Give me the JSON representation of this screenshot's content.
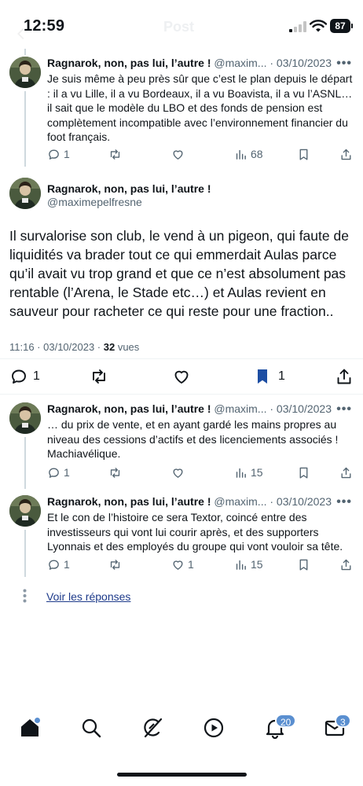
{
  "status_bar": {
    "time": "12:59",
    "header_title_faded": "Post",
    "battery": "87"
  },
  "tweets_top": [
    {
      "name": "Ragnarok, non, pas lui, l’autre !",
      "handle_date": " @maxim... · 03/10/2023",
      "text": "Je suis même à peu près sûr que c’est le plan depuis le départ : il a vu Lille, il a vu Bordeaux, il a vu Boavista, il a vu l’ASNL… il sait que le modèle du LBO et des fonds de pension est complètement incompatible avec l’environnement financier du foot français.",
      "replies": "1",
      "retweets": "",
      "likes": "",
      "views": "68"
    }
  ],
  "main_tweet": {
    "name": "Ragnarok, non, pas lui, l’autre !",
    "handle": "@maximepelfresne",
    "text": "Il survalorise son club, le vend à un pigeon, qui faute de liquidités va brader tout ce qui emmerdait Aulas parce qu’il avait vu trop grand et que ce n’est absolument pas rentable (l’Arena, le Stade etc…) et Aulas revient en sauveur pour racheter ce qui reste pour une fraction..",
    "timestamp": "11:16 · 03/10/2023 · ",
    "views_count": "32",
    "views_label": " vues",
    "replies": "1",
    "bookmarks": "1"
  },
  "tweets_bottom": [
    {
      "name": "Ragnarok, non, pas lui, l’autre !",
      "handle_date": " @maxim... · 03/10/2023",
      "text": "… du prix de vente, et en ayant gardé les mains propres au niveau des cessions d’actifs et des licenciements associés ! Machiavélique.",
      "replies": "1",
      "likes": "",
      "views": "15"
    },
    {
      "name": "Ragnarok, non, pas lui, l’autre !",
      "handle_date": " @maxim... · 03/10/2023",
      "text": "Et le con de l’histoire ce sera Textor, coincé entre des investisseurs qui vont lui courir après, et des supporters Lyonnais et des employés du groupe qui vont vouloir sa tête.",
      "replies": "1",
      "likes": "1",
      "views": "15"
    }
  ],
  "replies_link": "Voir les réponses",
  "bottom_nav": {
    "notifications_badge": "20",
    "messages_badge": "3"
  },
  "icons": [
    "reply-icon",
    "retweet-icon",
    "like-icon",
    "views-icon",
    "bookmark-icon",
    "share-icon",
    "home-icon",
    "search-icon",
    "grok-icon",
    "video-icon",
    "bell-icon",
    "mail-icon"
  ],
  "colors": {
    "accent": "#1d4ea3",
    "badge": "#5a8fd0",
    "muted": "#536471"
  }
}
